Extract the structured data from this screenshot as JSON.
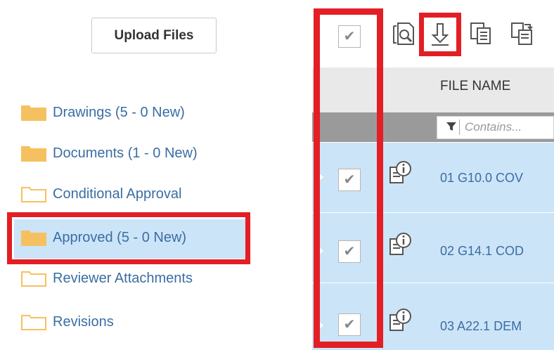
{
  "sidebar": {
    "upload_label": "Upload Files",
    "folders": [
      {
        "label": "Drawings (5 - 0 New)",
        "filled": true
      },
      {
        "label": "Documents (1 - 0 New)",
        "filled": true
      },
      {
        "label": "Conditional Approval",
        "filled": false
      },
      {
        "label": "Approved (5 - 0 New)",
        "filled": true,
        "selected": true
      },
      {
        "label": "Reviewer Attachments",
        "filled": false
      },
      {
        "label": "Revisions",
        "filled": false
      }
    ]
  },
  "toolbar": {
    "icons": [
      "search-document-icon",
      "download-icon",
      "copy-icon",
      "move-icon"
    ]
  },
  "grid": {
    "column_header": "FILE NAME",
    "filter_placeholder": "Contains...",
    "rows": [
      {
        "name": "01 G10.0 COV",
        "checked": true
      },
      {
        "name": "02 G14.1 COD",
        "checked": true
      },
      {
        "name": "03 A22.1 DEM",
        "checked": true
      }
    ]
  },
  "colors": {
    "highlight": "#e31e24",
    "selection": "#cce4f7",
    "folder": "#f5c160",
    "link_text": "#3a6da3"
  }
}
